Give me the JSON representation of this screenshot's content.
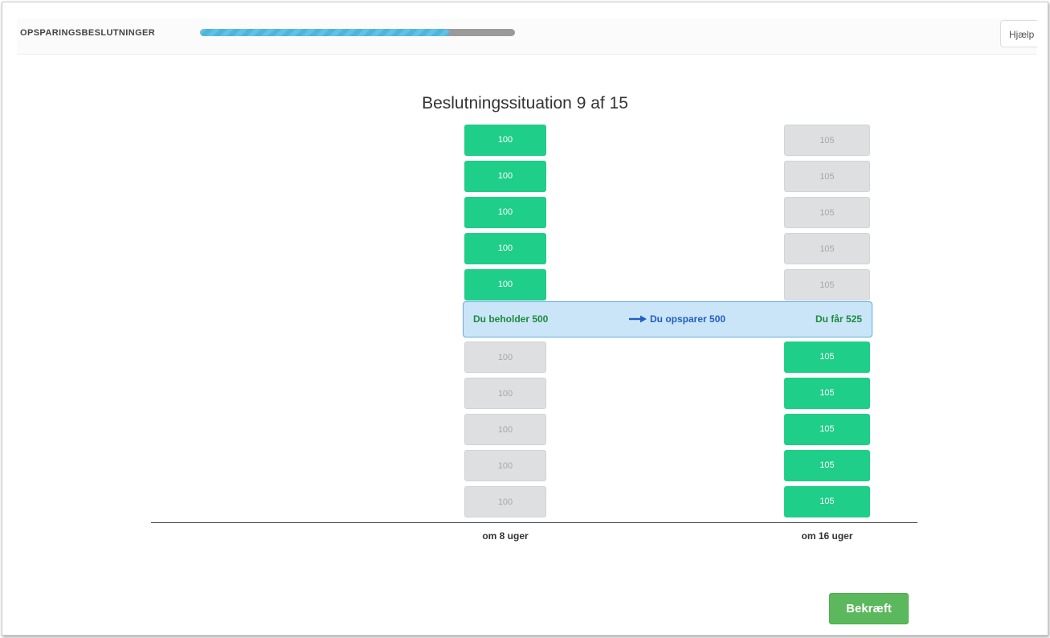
{
  "header": {
    "title": "OPSPARINGSBESLUTNINGER",
    "progress_fraction": 0.79,
    "help_label": "Hjælp"
  },
  "situation": {
    "title": "Beslutningssituation 9 af 15"
  },
  "columns": {
    "left": {
      "value": "100",
      "label": "om 8 uger",
      "cells": [
        "100",
        "100",
        "100",
        "100",
        "100",
        "100",
        "100",
        "100",
        "100",
        "100"
      ],
      "selected_count": 5
    },
    "right": {
      "value": "105",
      "label": "om 16 uger",
      "cells": [
        "105",
        "105",
        "105",
        "105",
        "105",
        "105",
        "105",
        "105",
        "105",
        "105"
      ],
      "selected_count": 5
    }
  },
  "decision": {
    "keep_label": "Du beholder 500",
    "save_label": "Du opsparer 500",
    "get_label": "Du får 525",
    "arrow_icon": "arrow-right-icon"
  },
  "actions": {
    "confirm_label": "Bekræft"
  },
  "colors": {
    "selected": "#1fce88",
    "unselected": "#dedfe1",
    "decision_bg": "#cbe5f8",
    "decision_border": "#62a9e4",
    "confirm": "#5cb85c",
    "progress": "#5ec4e6"
  }
}
